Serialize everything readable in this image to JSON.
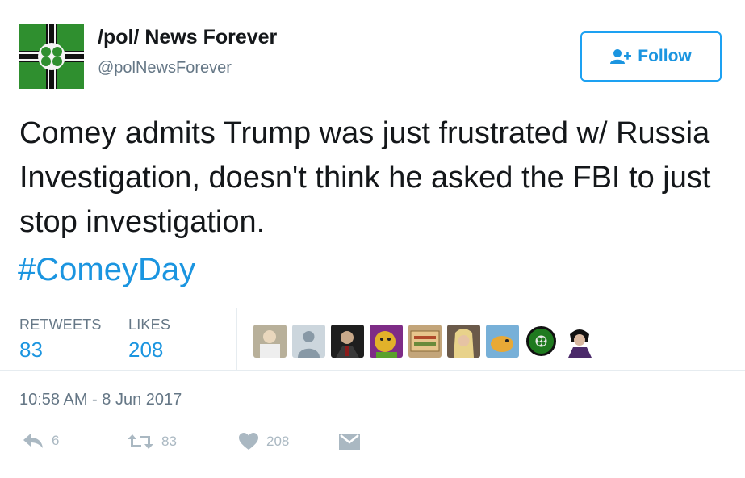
{
  "author": {
    "display_name": "/pol/ News Forever",
    "handle": "@polNewsForever",
    "avatar_icon": "green-cross-flag-avatar"
  },
  "follow_button": {
    "label": "Follow",
    "icon": "add-user-icon"
  },
  "tweet": {
    "text": "Comey admits Trump was just frustrated w/ Russia Investigation, doesn't think he asked the FBI to just stop investigation.",
    "hashtag": "#ComeyDay"
  },
  "stats": {
    "retweets_label": "RETWEETS",
    "retweets_value": "83",
    "likes_label": "LIKES",
    "likes_value": "208"
  },
  "likers": [
    "liker-1",
    "liker-2",
    "liker-3",
    "liker-4",
    "liker-5",
    "liker-6",
    "liker-7",
    "liker-8",
    "liker-9"
  ],
  "timestamp": "10:58 AM - 8 Jun 2017",
  "actions": {
    "reply_count": "6",
    "retweet_count": "83",
    "like_count": "208"
  },
  "colors": {
    "accent": "#1b95e0",
    "muted": "#657786",
    "action_gray": "#aab8c2"
  }
}
